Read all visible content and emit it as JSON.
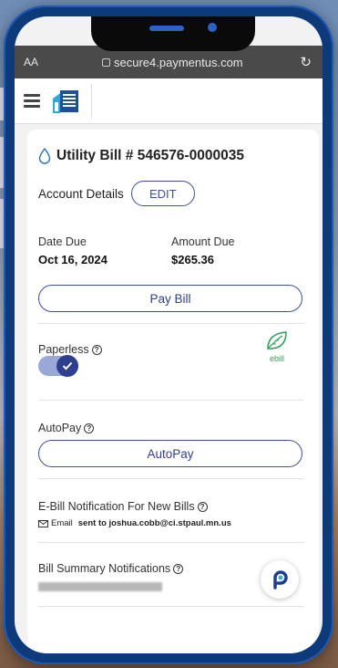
{
  "browser": {
    "text_size_label": "AA",
    "url": "secure4.paymentus.com",
    "reload_glyph": "↻"
  },
  "bill": {
    "title": "Utility Bill # 546576-0000035",
    "account_details_label": "Account Details",
    "edit_label": "EDIT",
    "date_due_label": "Date Due",
    "date_due_value": "Oct 16, 2024",
    "amount_due_label": "Amount Due",
    "amount_due_value": "$265.36",
    "pay_bill_label": "Pay Bill"
  },
  "paperless": {
    "label": "Paperless",
    "enabled": true,
    "ebill_label": "ebill"
  },
  "autopay": {
    "label": "AutoPay",
    "button_label": "AutoPay"
  },
  "ebill_notification": {
    "label": "E-Bill Notification For New Bills",
    "email_prefix": "Email",
    "email_text": "sent to joshua.cobb@ci.stpaul.mn.us"
  },
  "summary_notifications": {
    "label": "Bill Summary Notifications"
  },
  "colors": {
    "accent": "#3e4e9e",
    "ebill_green": "#2ea055",
    "frame_blue": "#0c3a7a"
  }
}
